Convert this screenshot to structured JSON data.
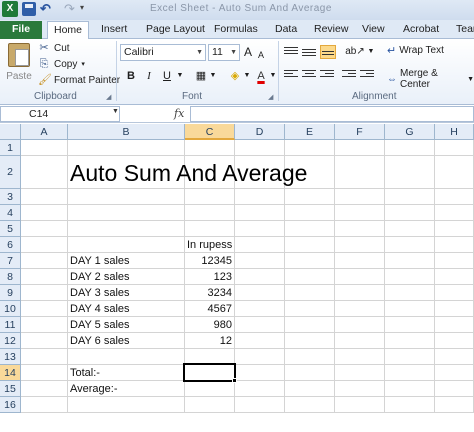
{
  "titlebar": {
    "title": "Excel Sheet - Auto Sum And Average",
    "logo": "X"
  },
  "tabs": [
    "File",
    "Home",
    "Insert",
    "Page Layout",
    "Formulas",
    "Data",
    "Review",
    "View",
    "Acrobat",
    "Tear"
  ],
  "ribbon": {
    "clipboard": {
      "paste": "Paste",
      "cut": "Cut",
      "copy": "Copy",
      "copy_dd": "▾",
      "format_painter": "Format Painter",
      "group": "Clipboard"
    },
    "font": {
      "name": "Calibri",
      "size": "11",
      "bold": "B",
      "italic": "I",
      "underline": "U",
      "grow": "A",
      "shrink": "A",
      "group": "Font"
    },
    "alignment": {
      "wrap_text": "Wrap Text",
      "merge_center": "Merge & Center",
      "group": "Alignment"
    }
  },
  "formula_bar": {
    "name_box": "C14",
    "fx": "fx",
    "value": ""
  },
  "columns": [
    "A",
    "B",
    "C",
    "D",
    "E",
    "F",
    "G",
    "H"
  ],
  "active_column": "C",
  "rows": [
    "1",
    "2",
    "3",
    "4",
    "5",
    "6",
    "7",
    "8",
    "9",
    "10",
    "11",
    "12",
    "13",
    "14",
    "15",
    "16"
  ],
  "active_row": "14",
  "sheet": {
    "title": "Auto Sum And Average",
    "header": "In rupess",
    "entries": [
      {
        "label": "DAY 1 sales",
        "value": "12345"
      },
      {
        "label": "DAY 2 sales",
        "value": "123"
      },
      {
        "label": "DAY 3 sales",
        "value": "3234"
      },
      {
        "label": "DAY 4 sales",
        "value": "4567"
      },
      {
        "label": "DAY 5 sales",
        "value": "980"
      },
      {
        "label": "DAY 6 sales",
        "value": "12"
      }
    ],
    "total_label": "Total:-",
    "average_label": "Average:-"
  }
}
